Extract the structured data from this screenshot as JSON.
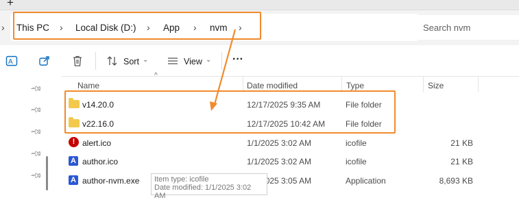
{
  "tab": {
    "new_tab_label": "+"
  },
  "breadcrumb": {
    "items": [
      "This PC",
      "Local Disk (D:)",
      "App",
      "nvm"
    ]
  },
  "search": {
    "placeholder": "Search nvm"
  },
  "toolbar": {
    "sort_label": "Sort",
    "view_label": "View",
    "more_label": "···"
  },
  "columns": {
    "name": "Name",
    "date_modified": "Date modified",
    "type": "Type",
    "size": "Size"
  },
  "files": [
    {
      "name": "v14.20.0",
      "date": "12/17/2025 9:35 AM",
      "type": "File folder",
      "size": "",
      "icon": "folder-icon"
    },
    {
      "name": "v22.16.0",
      "date": "12/17/2025 10:42 AM",
      "type": "File folder",
      "size": "",
      "icon": "folder-icon"
    },
    {
      "name": "alert.ico",
      "date": "1/1/2025 3:02 AM",
      "type": "icofile",
      "size": "21 KB",
      "icon": "alert-icon"
    },
    {
      "name": "author.ico",
      "date": "1/1/2025 3:02 AM",
      "type": "icofile",
      "size": "21 KB",
      "icon": "app-icon"
    },
    {
      "name": "author-nvm.exe",
      "date": "1/1/2025 3:05 AM",
      "type": "Application",
      "size": "8,693 KB",
      "icon": "app-icon"
    }
  ],
  "tooltip": {
    "line1": "Item type: icofile",
    "line2": "Date modified: 1/1/2025 3:02 AM"
  },
  "colors": {
    "annotation": "#f08a2c",
    "accent": "#0f6cbd",
    "folder": "#f2c94c"
  }
}
